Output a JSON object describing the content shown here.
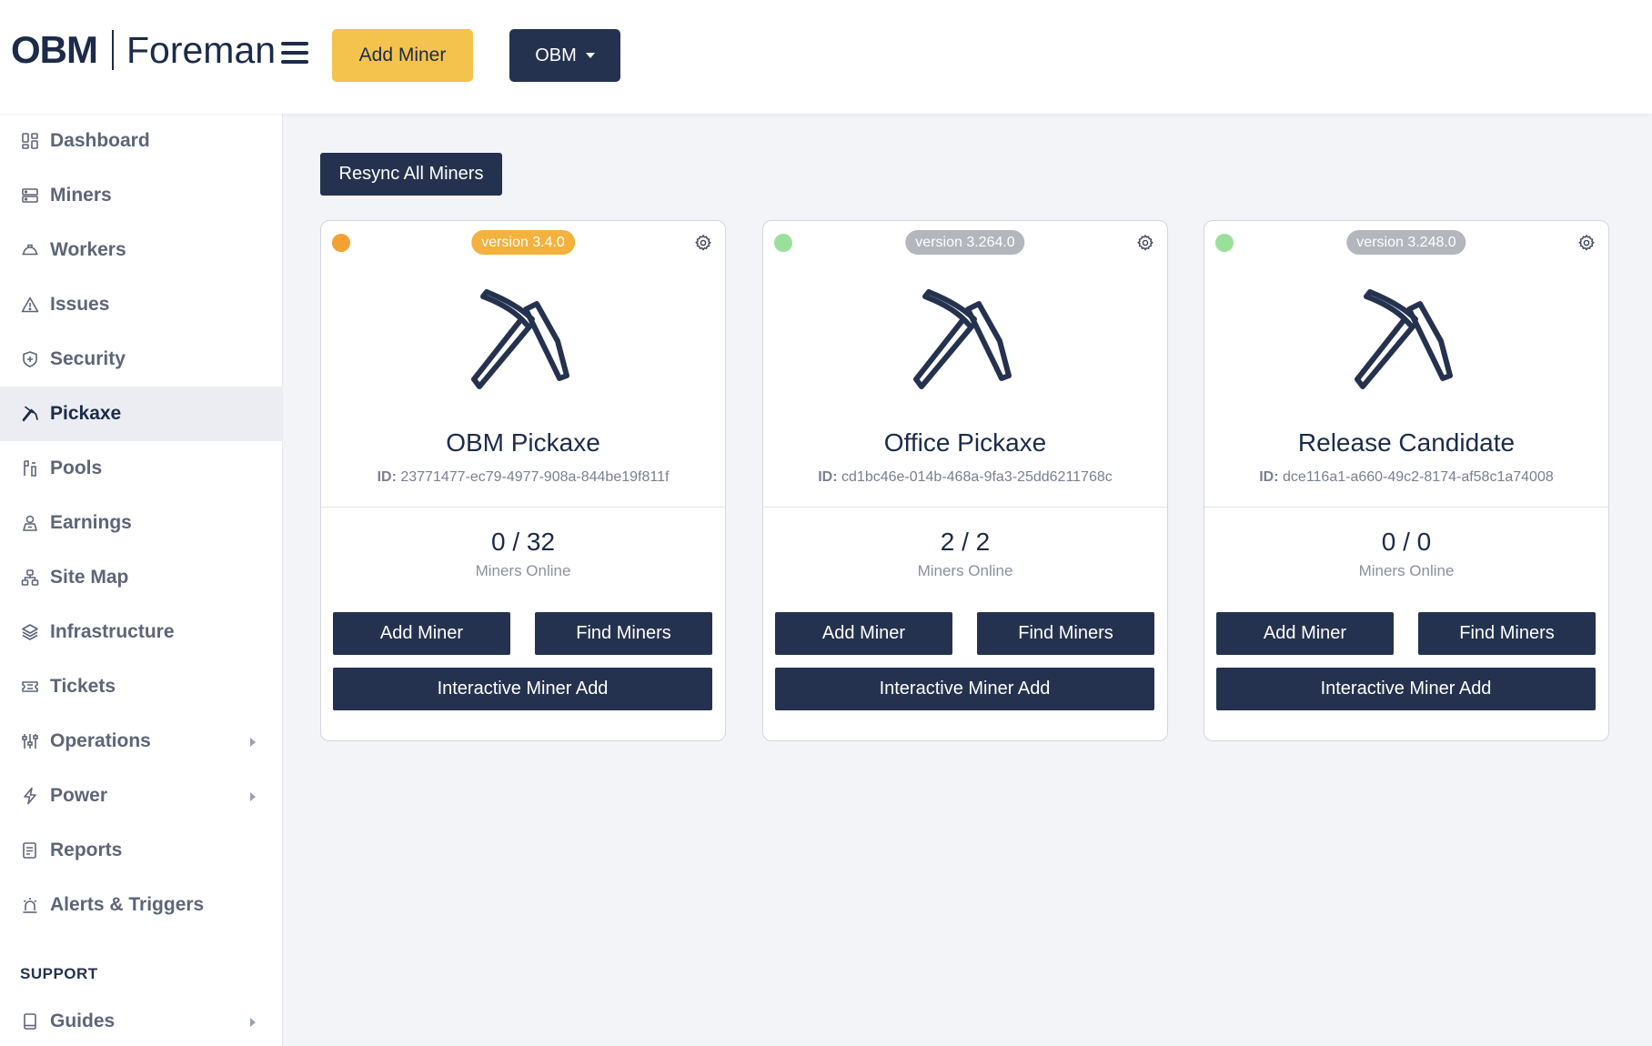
{
  "header": {
    "logo_brand": "OBM",
    "logo_product": "Foreman",
    "add_miner_label": "Add Miner",
    "org_selector_label": "OBM"
  },
  "sidebar": {
    "items": [
      {
        "label": "Dashboard",
        "icon": "dashboard-icon"
      },
      {
        "label": "Miners",
        "icon": "server-icon"
      },
      {
        "label": "Workers",
        "icon": "hardhat-icon"
      },
      {
        "label": "Issues",
        "icon": "warning-icon"
      },
      {
        "label": "Security",
        "icon": "shield-icon"
      },
      {
        "label": "Pickaxe",
        "icon": "pickaxe-icon",
        "active": true
      },
      {
        "label": "Pools",
        "icon": "pools-icon"
      },
      {
        "label": "Earnings",
        "icon": "coins-icon"
      },
      {
        "label": "Site Map",
        "icon": "sitemap-icon"
      },
      {
        "label": "Infrastructure",
        "icon": "layers-icon"
      },
      {
        "label": "Tickets",
        "icon": "ticket-icon"
      },
      {
        "label": "Operations",
        "icon": "sliders-icon",
        "expandable": true
      },
      {
        "label": "Power",
        "icon": "bolt-icon",
        "expandable": true
      },
      {
        "label": "Reports",
        "icon": "report-icon"
      },
      {
        "label": "Alerts & Triggers",
        "icon": "alarm-icon"
      }
    ],
    "support_section_label": "SUPPORT",
    "support_items": [
      {
        "label": "Guides",
        "icon": "book-icon",
        "expandable": true
      }
    ]
  },
  "main": {
    "resync_label": "Resync All Miners",
    "cards": [
      {
        "name": "OBM Pickaxe",
        "id_label": "ID:",
        "id_value": "23771477-ec79-4977-908a-844be19f811f",
        "version": "version 3.4.0",
        "version_color": "#f4b13d",
        "status_color": "#f4a133",
        "count": "0 / 32",
        "count_label": "Miners Online",
        "add_label": "Add Miner",
        "find_label": "Find Miners",
        "interactive_label": "Interactive Miner Add"
      },
      {
        "name": "Office Pickaxe",
        "id_label": "ID:",
        "id_value": "cd1bc46e-014b-468a-9fa3-25dd6211768c",
        "version": "version 3.264.0",
        "version_color": "#b3b6bd",
        "status_color": "#9be09a",
        "count": "2 / 2",
        "count_label": "Miners Online",
        "add_label": "Add Miner",
        "find_label": "Find Miners",
        "interactive_label": "Interactive Miner Add"
      },
      {
        "name": "Release Candidate",
        "id_label": "ID:",
        "id_value": "dce116a1-a660-49c2-8174-af58c1a74008",
        "version": "version 3.248.0",
        "version_color": "#b3b6bd",
        "status_color": "#9be09a",
        "count": "0 / 0",
        "count_label": "Miners Online",
        "add_label": "Add Miner",
        "find_label": "Find Miners",
        "interactive_label": "Interactive Miner Add"
      }
    ]
  },
  "colors": {
    "navy": "#25324f",
    "accent_yellow": "#f4c34d",
    "background": "#f3f4f8"
  }
}
